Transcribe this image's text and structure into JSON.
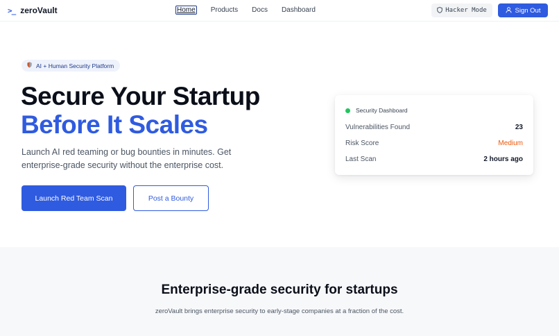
{
  "header": {
    "logo_icon": ">_",
    "logo_text": "zeroVault",
    "nav": [
      {
        "label": "Home",
        "active": true
      },
      {
        "label": "Products"
      },
      {
        "label": "Docs"
      },
      {
        "label": "Dashboard"
      }
    ],
    "hacker_mode_label": "Hacker Mode",
    "hacker_mode_icon": "shield-icon",
    "sign_out_label": "Sign Out",
    "sign_out_icon": "user-icon"
  },
  "hero": {
    "badge_icon": "shield-icon",
    "badge_label": "AI + Human Security Platform",
    "title_line1": "Secure Your Startup",
    "title_line2": "Before It Scales",
    "subtitle": "Launch AI red teaming or bug bounties in minutes. Get enterprise-grade security without the enterprise cost.",
    "primary_cta": "Launch Red Team Scan",
    "secondary_cta": "Post a Bounty"
  },
  "dashboard_card": {
    "title": "Security Dashboard",
    "status_color": "#22c55e",
    "rows": [
      {
        "label": "Vulnerabilities Found",
        "value": "23"
      },
      {
        "label": "Risk Score",
        "value": "Medium",
        "value_color": "#ea580c"
      },
      {
        "label": "Last Scan",
        "value": "2 hours ago"
      }
    ]
  },
  "features": {
    "title": "Enterprise-grade security for startups",
    "subtitle": "zeroVault brings enterprise security to early-stage companies at a fraction of the cost."
  },
  "colors": {
    "accent": "#2f5be0",
    "warning": "#ea580c",
    "success": "#22c55e"
  }
}
